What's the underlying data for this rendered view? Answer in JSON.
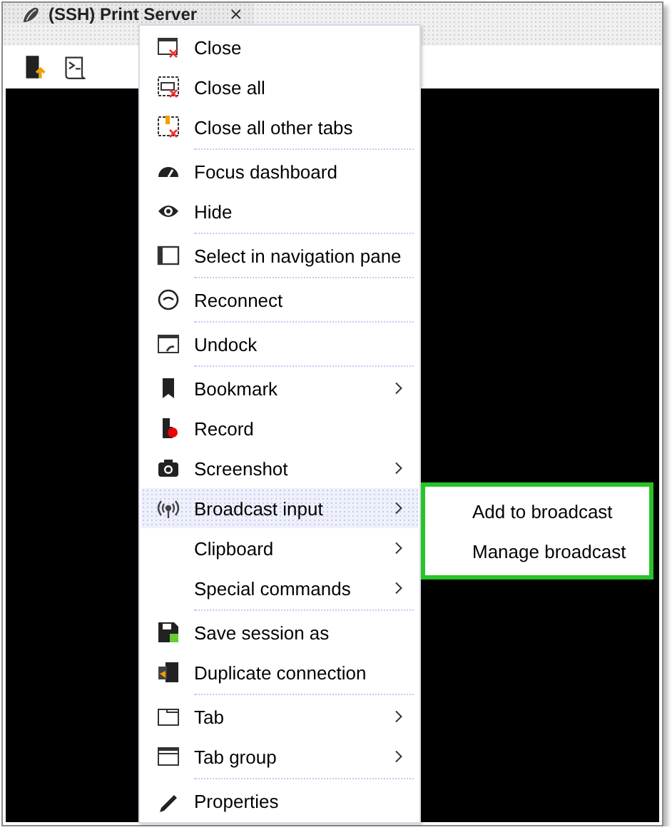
{
  "tab": {
    "title": "(SSH) Print Server",
    "close": "×"
  },
  "context_menu": {
    "groups": [
      [
        {
          "label": "Close",
          "submenu": false,
          "highlighted": false
        },
        {
          "label": "Close all",
          "submenu": false,
          "highlighted": false
        },
        {
          "label": "Close all other tabs",
          "submenu": false,
          "highlighted": false
        }
      ],
      [
        {
          "label": "Focus dashboard",
          "submenu": false,
          "highlighted": false
        },
        {
          "label": "Hide",
          "submenu": false,
          "highlighted": false
        }
      ],
      [
        {
          "label": "Select in navigation pane",
          "submenu": false,
          "highlighted": false
        }
      ],
      [
        {
          "label": "Reconnect",
          "submenu": false,
          "highlighted": false
        }
      ],
      [
        {
          "label": "Undock",
          "submenu": false,
          "highlighted": false
        }
      ],
      [
        {
          "label": "Bookmark",
          "submenu": true,
          "highlighted": false
        },
        {
          "label": "Record",
          "submenu": false,
          "highlighted": false
        },
        {
          "label": "Screenshot",
          "submenu": true,
          "highlighted": false
        },
        {
          "label": "Broadcast input",
          "submenu": true,
          "highlighted": true
        },
        {
          "label": "Clipboard",
          "submenu": true,
          "highlighted": false
        },
        {
          "label": "Special commands",
          "submenu": true,
          "highlighted": false
        }
      ],
      [
        {
          "label": "Save session as",
          "submenu": false,
          "highlighted": false
        },
        {
          "label": "Duplicate connection",
          "submenu": false,
          "highlighted": false
        }
      ],
      [
        {
          "label": "Tab",
          "submenu": true,
          "highlighted": false
        },
        {
          "label": "Tab group",
          "submenu": true,
          "highlighted": false
        }
      ],
      [
        {
          "label": "Properties",
          "submenu": false,
          "highlighted": false
        }
      ]
    ]
  },
  "submenu": {
    "items": [
      "Add to broadcast",
      "Manage broadcast"
    ]
  }
}
